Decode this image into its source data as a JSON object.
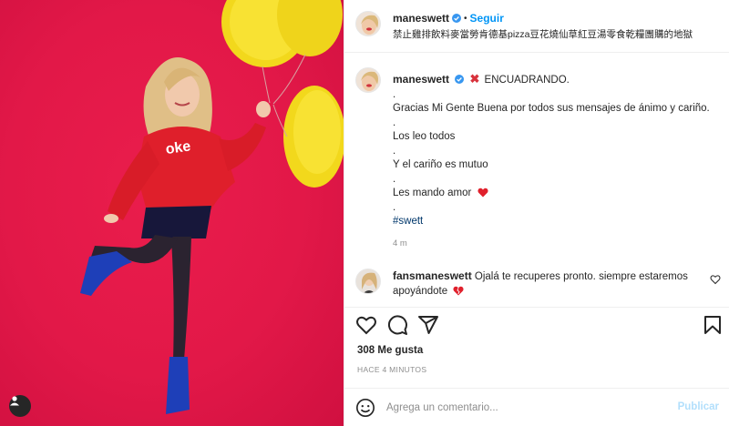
{
  "post": {
    "username": "maneswett",
    "follow_label": "Seguir",
    "separator": "•",
    "location": "禁止雞排飲料麥當勞肯德基pizza豆花燒仙草紅豆湯零食乾糧團購的地獄"
  },
  "caption": {
    "username": "maneswett",
    "title": "ENCUADRANDO.",
    "lines": [
      ".",
      "Gracias Mi Gente Buena por todos sus mensajes de ánimo y cariño.",
      ".",
      "Los leo todos",
      ".",
      "Y el cariño es mutuo",
      ".",
      "Les mando amor",
      ".",
      "#swett"
    ],
    "time": "4 m"
  },
  "comment": {
    "username": "fansmaneswett",
    "text": "Ojalá te recuperes pronto. siempre estaremos apoyándote"
  },
  "stats": {
    "likes": "308 Me gusta",
    "time_ago": "HACE 4 MINUTOS"
  },
  "composer": {
    "placeholder": "Agrega un comentario...",
    "publish_label": "Publicar"
  },
  "icons": {
    "verified": "verified-badge-icon",
    "like": "heart-icon",
    "comment": "comment-icon",
    "share": "share-icon",
    "save": "bookmark-icon",
    "emoji": "emoji-icon",
    "user_tag": "user-tag-icon"
  },
  "colors": {
    "accent": "#0095f6",
    "background_photo": "#e21848",
    "verified": "#3897f0",
    "heart": "#ed4956",
    "publish_disabled": "#b2dffc"
  }
}
